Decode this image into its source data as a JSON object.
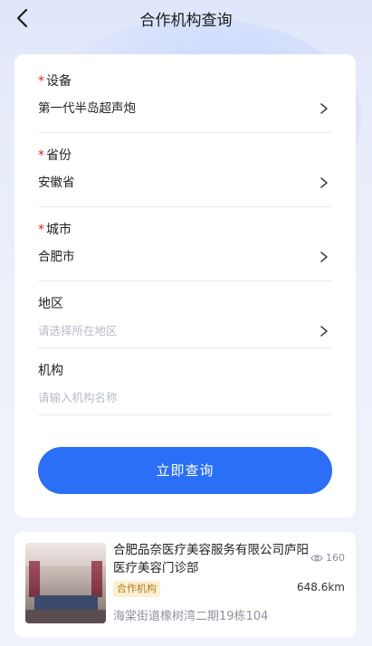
{
  "nav": {
    "title": "合作机构查询"
  },
  "form": {
    "device": {
      "label": "设备",
      "required_mark": "*",
      "value": "第一代半岛超声炮"
    },
    "province": {
      "label": "省份",
      "required_mark": "*",
      "value": "安徽省"
    },
    "city": {
      "label": "城市",
      "required_mark": "*",
      "value": "合肥市"
    },
    "region": {
      "label": "地区",
      "placeholder": "请选择所在地区"
    },
    "institution": {
      "label": "机构",
      "placeholder": "请输入机构名称"
    },
    "submit_label": "立即查询"
  },
  "results": [
    {
      "name": "合肥品奈医疗美容服务有限公司庐阳医疗美容门诊部",
      "views": "160",
      "tag": "合作机构",
      "distance": "648.6km",
      "address": "海棠街道橡树湾二期19栋104"
    }
  ],
  "colors": {
    "accent": "#2a6ff5",
    "required": "#e02020",
    "tag_bg": "#fdf0d2",
    "tag_text": "#b07a1e"
  },
  "icons": {
    "back": "chevron-left-icon",
    "field_arrow": "chevron-right-icon",
    "views": "eye-icon"
  }
}
